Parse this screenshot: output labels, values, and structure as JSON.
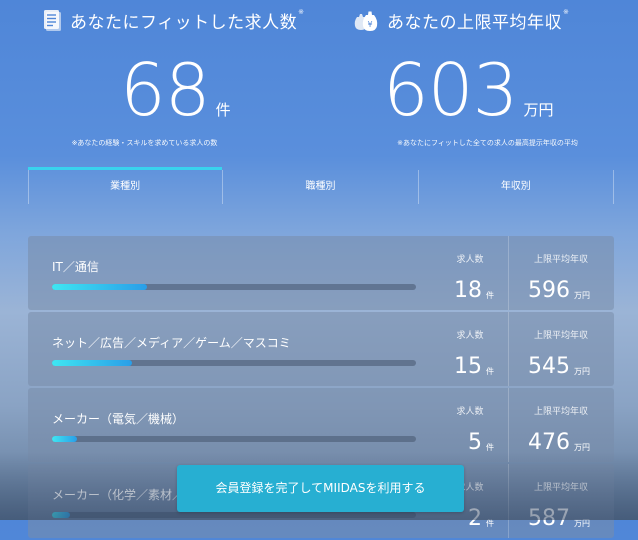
{
  "stats": [
    {
      "icon": "document-icon",
      "title": "あなたにフィットした求人数",
      "mark": "※",
      "value": "68",
      "unit": "件",
      "note": "※あなたの経験・スキルを求めている求人の数"
    },
    {
      "icon": "money-bag-icon",
      "title": "あなたの上限平均年収",
      "mark": "※",
      "value": "603",
      "unit": "万円",
      "note": "※あなたにフィットした全ての求人の最高提示年収の平均"
    }
  ],
  "tabs": [
    "業種別",
    "職種別",
    "年収別"
  ],
  "active_tab": "業種別",
  "columns": {
    "count_label": "求人数",
    "salary_label": "上限平均年収"
  },
  "units": {
    "count": "件",
    "salary": "万円"
  },
  "industries": [
    {
      "name": "IT／通信",
      "count": "18",
      "salary": "596",
      "bar_fraction": 0.26
    },
    {
      "name": "ネット／広告／メディア／ゲーム／マスコミ",
      "count": "15",
      "salary": "545",
      "bar_fraction": 0.22
    },
    {
      "name": "メーカー（電気／機械）",
      "count": "5",
      "salary": "476",
      "bar_fraction": 0.07
    },
    {
      "name": "メーカー（化学／素材／エ",
      "count": "2",
      "salary": "587",
      "bar_fraction": 0.05
    }
  ],
  "cta_label": "会員登録を完了してMIIDASを利用する",
  "colors": {
    "accent": "#39d3ee",
    "cta": "#27afd2",
    "bar_start": "#3fe6f2",
    "bar_end": "#2a9ee8"
  }
}
